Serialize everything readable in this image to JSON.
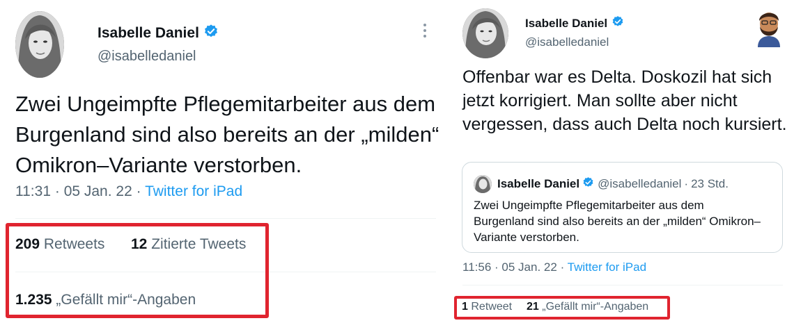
{
  "left_tweet": {
    "author_name": "Isabelle Daniel",
    "handle": "@isabelledaniel",
    "text": "Zwei Ungeimpfte Pflegemitarbeiter aus dem Burgenland sind also bereits an der „milden“ Omikron–Variante verstorben.",
    "time": "11:31",
    "date": "05 Jan. 22",
    "separator": "·",
    "source": "Twitter for iPad",
    "retweets_count": "209",
    "retweets_label": "Retweets",
    "quotes_count": "12",
    "quotes_label": "Zitierte Tweets",
    "likes_count": "1.235",
    "likes_label": "„Gefällt mir“-Angaben"
  },
  "right_tweet": {
    "author_name": "Isabelle Daniel",
    "handle": "@isabelledaniel",
    "text": "Offenbar war es Delta. Doskozil hat sich jetzt korrigiert. Man sollte aber nicht vergessen, dass auch Delta noch kursiert.",
    "quoted": {
      "author_name": "Isabelle Daniel",
      "handle": "@isabelledaniel",
      "age": "23 Std.",
      "text": "Zwei Ungeimpfte Pflegemitarbeiter aus dem Burgenland sind also bereits an der „milden“ Omikron–Variante verstorben."
    },
    "time": "11:56",
    "date": "05 Jan. 22",
    "source": "Twitter for iPad",
    "retweets_count": "1",
    "retweets_label": "Retweet",
    "likes_count": "21",
    "likes_label": "„Gefällt mir“-Angaben"
  },
  "colors": {
    "text": "#0f1419",
    "muted": "#536471",
    "link": "#1d9bf0",
    "verified": "#1d9bf0",
    "highlight_box": "#e0242f"
  },
  "icons": [
    "verified-badge-icon",
    "more-options-icon",
    "profile-avatar",
    "emoji-avatar-icon"
  ]
}
